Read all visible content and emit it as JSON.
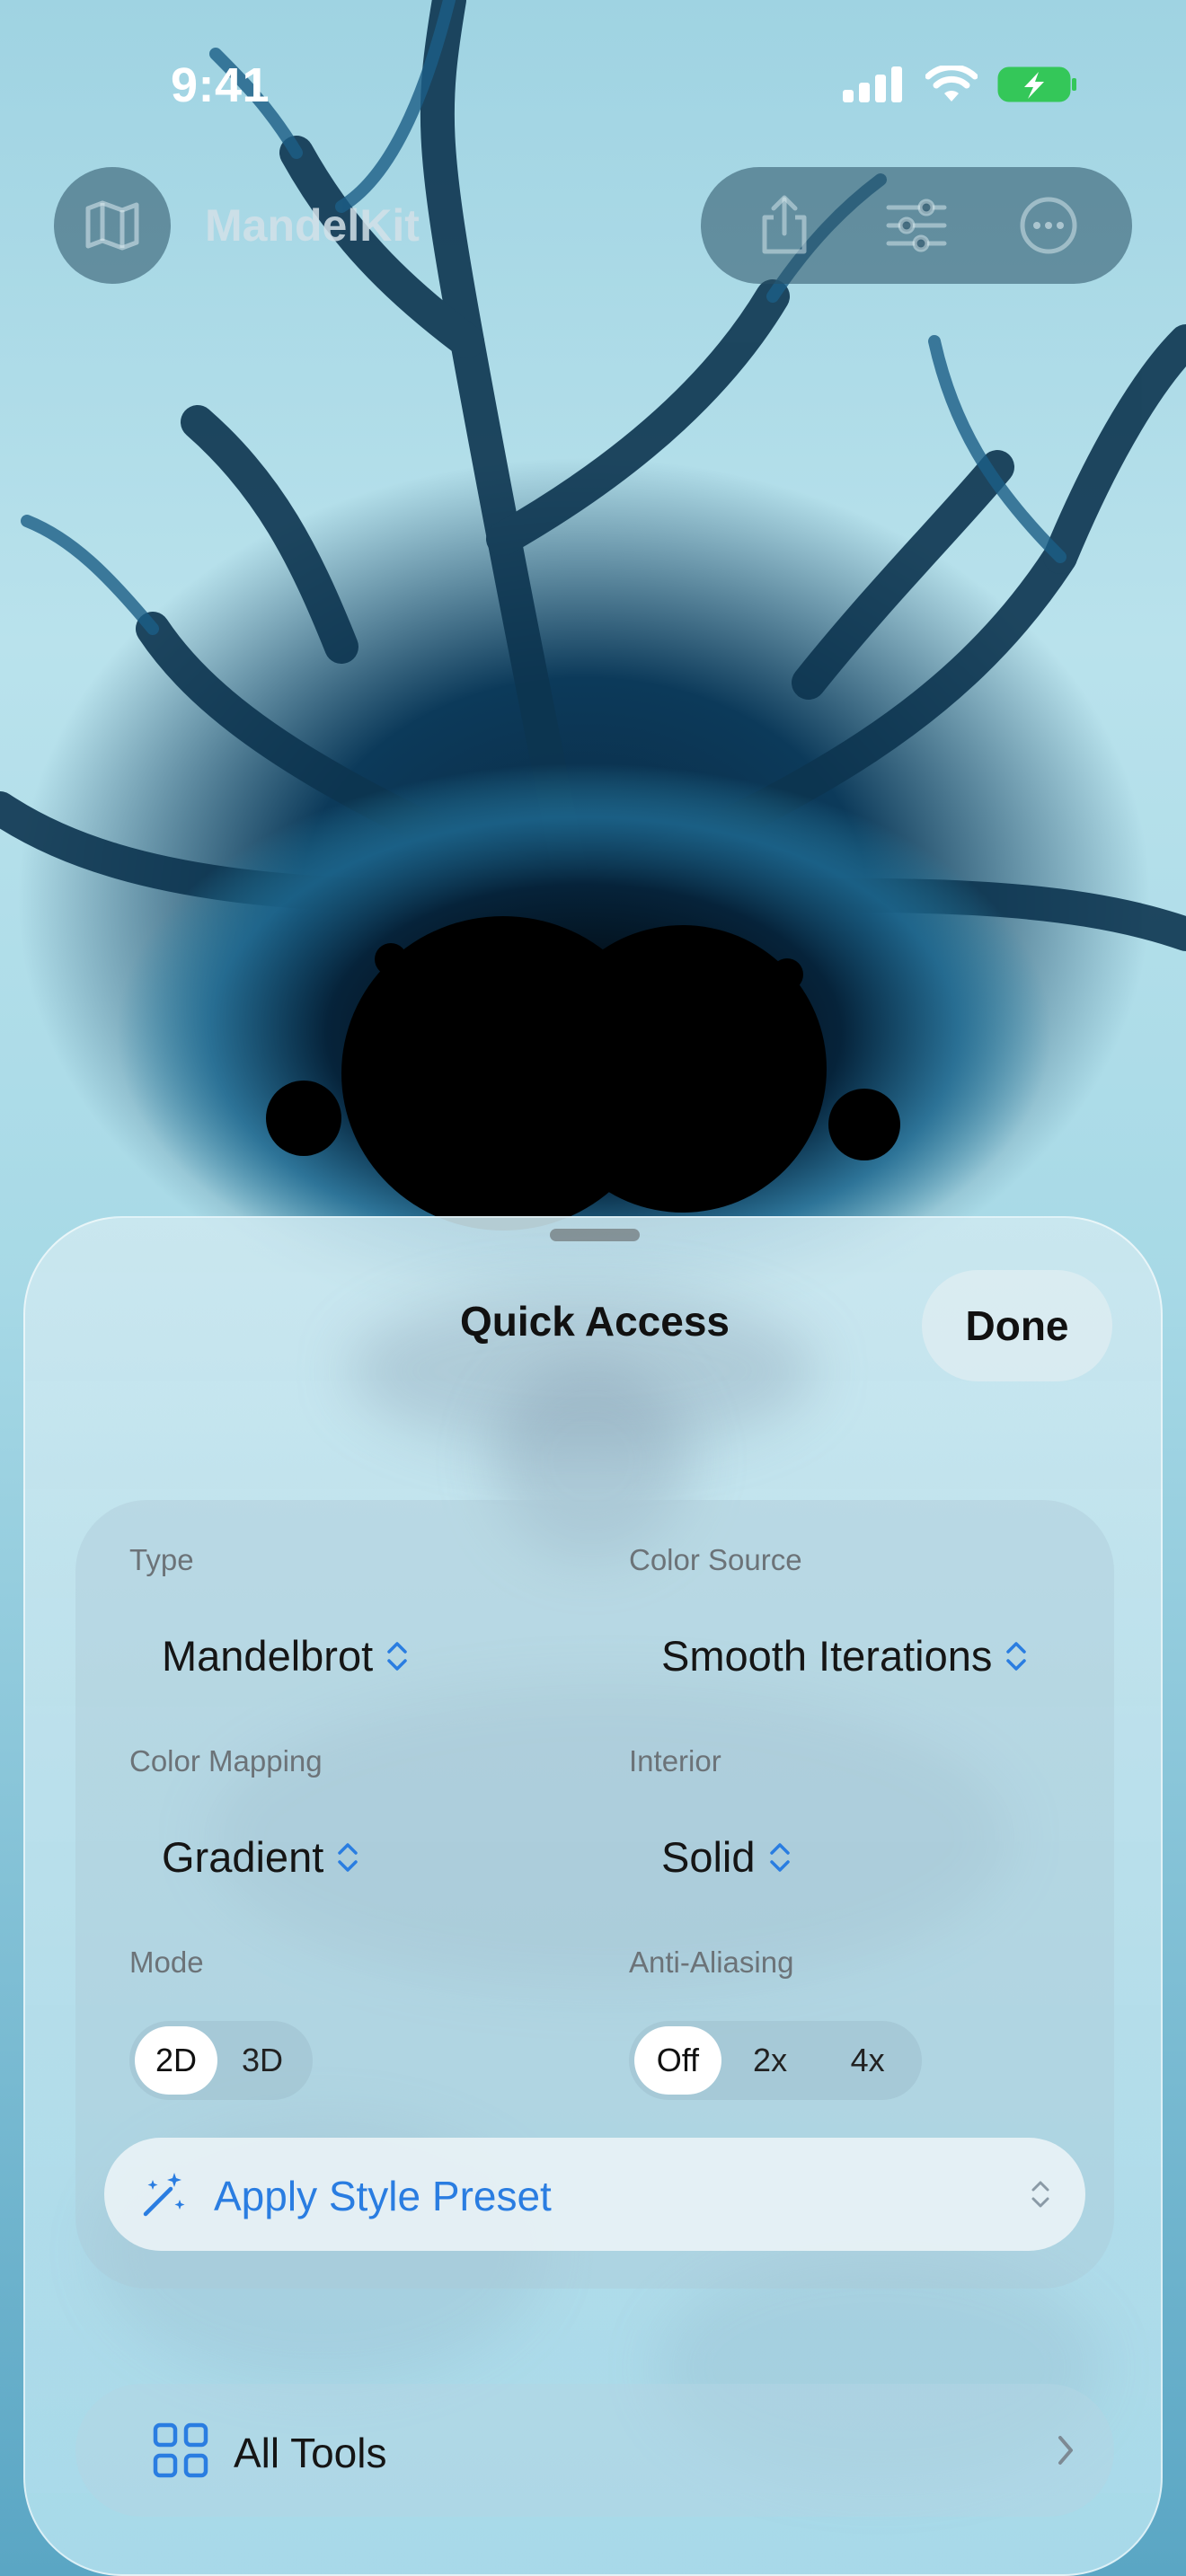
{
  "status_bar": {
    "time": "9:41"
  },
  "toolbar": {
    "app_title": "MandelKit",
    "map_icon": "map-icon",
    "share_icon": "share-icon",
    "sliders_icon": "sliders-icon",
    "more_icon": "ellipsis-circle-icon"
  },
  "sheet": {
    "title": "Quick Access",
    "done_label": "Done",
    "fields": {
      "type": {
        "label": "Type",
        "value": "Mandelbrot"
      },
      "color_source": {
        "label": "Color Source",
        "value": "Smooth Iterations"
      },
      "color_mapping": {
        "label": "Color Mapping",
        "value": "Gradient"
      },
      "interior": {
        "label": "Interior",
        "value": "Solid"
      }
    },
    "mode": {
      "label": "Mode",
      "options": [
        "2D",
        "3D"
      ],
      "selected": "2D"
    },
    "anti_aliasing": {
      "label": "Anti-Aliasing",
      "options": [
        "Off",
        "2x",
        "4x"
      ],
      "selected": "Off"
    },
    "preset_label": "Apply Style Preset",
    "all_tools_label": "All Tools"
  },
  "colors": {
    "accent": "#2a7de1",
    "battery": "#34c759"
  }
}
